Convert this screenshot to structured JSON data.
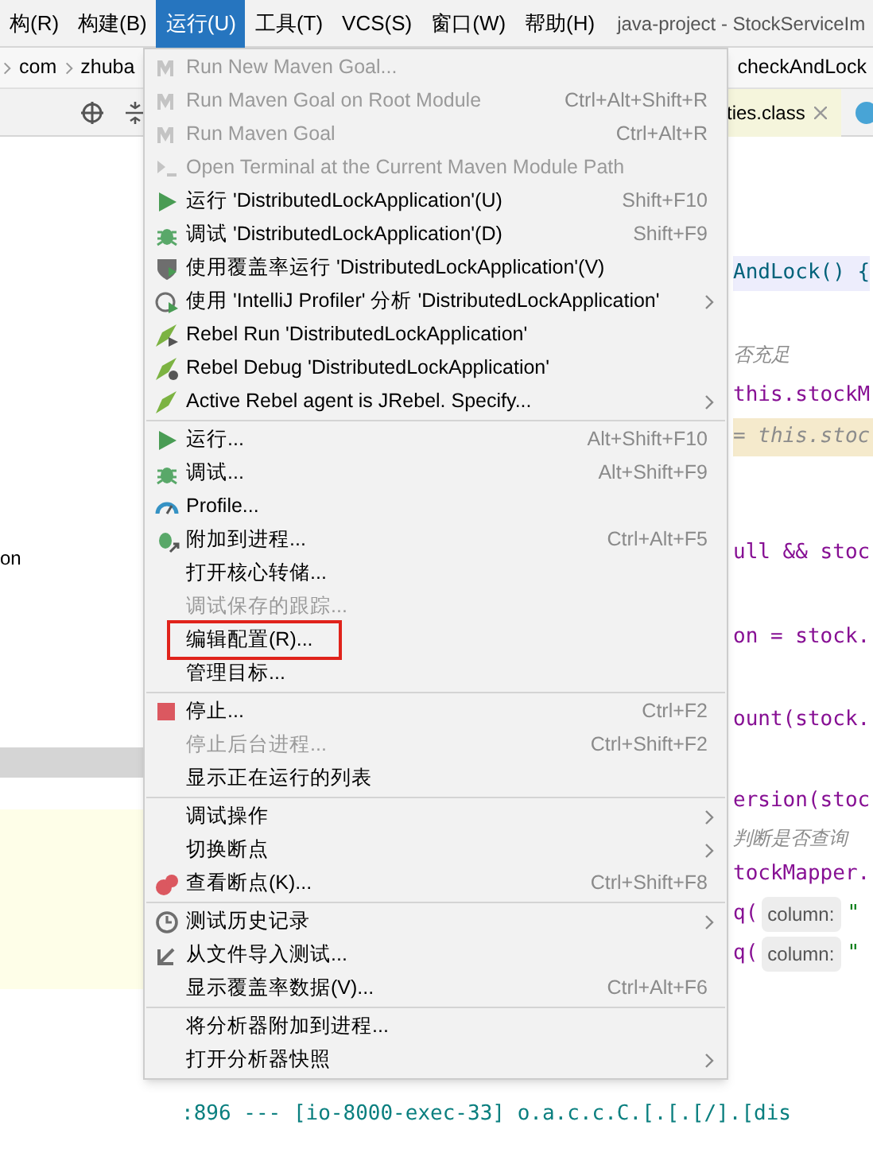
{
  "menubar": {
    "items": [
      {
        "label": "构(R)",
        "selected": false
      },
      {
        "label": "构建(B)",
        "selected": false
      },
      {
        "label": "运行(U)",
        "selected": true
      },
      {
        "label": "工具(T)",
        "selected": false
      },
      {
        "label": "VCS(S)",
        "selected": false
      },
      {
        "label": "窗口(W)",
        "selected": false
      },
      {
        "label": "帮助(H)",
        "selected": false
      }
    ],
    "title": "java-project - StockServiceIm"
  },
  "breadcrumb": {
    "items": [
      "com",
      "zhuba"
    ],
    "method": "checkAndLock"
  },
  "editor_tab": {
    "label": "ties.class"
  },
  "left_panel": {
    "text": "on"
  },
  "code_lines": [
    {
      "kind": "code",
      "text": "AndLock() {",
      "highlight": true
    },
    {
      "kind": "comment",
      "text": "否充足"
    },
    {
      "kind": "code",
      "text": "this.stockM"
    },
    {
      "kind": "current",
      "text": "= this.stoc"
    },
    {
      "kind": "code",
      "text": "ull && stoc"
    },
    {
      "kind": "code",
      "text": "on = stock."
    },
    {
      "kind": "code",
      "text": "ount(stock."
    },
    {
      "kind": "code",
      "text": "ersion(stoc"
    },
    {
      "kind": "comment",
      "text": "判断是否查询"
    },
    {
      "kind": "code",
      "text": "tockMapper."
    },
    {
      "kind": "hint",
      "text": "q(",
      "hint": "column:",
      "rest": "\""
    },
    {
      "kind": "hint",
      "text": "q(",
      "hint": "column:",
      "rest": "\""
    }
  ],
  "console_line": ":896 --- [io-8000-exec-33] o.a.c.c.C.[.[.[/].[dis",
  "run_menu": {
    "items": [
      {
        "kind": "item",
        "label": "Run New Maven Goal...",
        "disabled": true
      },
      {
        "kind": "item",
        "label": "Run Maven Goal on Root Module",
        "shortcut": "Ctrl+Alt+Shift+R",
        "disabled": true
      },
      {
        "kind": "item",
        "label": "Run Maven Goal",
        "shortcut": "Ctrl+Alt+R",
        "disabled": true
      },
      {
        "kind": "item",
        "label": "Open Terminal at the Current Maven Module Path",
        "disabled": true
      },
      {
        "kind": "item",
        "label": "运行 'DistributedLockApplication'(U)",
        "shortcut": "Shift+F10",
        "disabled": false
      },
      {
        "kind": "item",
        "label": "调试 'DistributedLockApplication'(D)",
        "shortcut": "Shift+F9",
        "disabled": false
      },
      {
        "kind": "item",
        "label": "使用覆盖率运行  'DistributedLockApplication'(V)",
        "disabled": false
      },
      {
        "kind": "item",
        "label": "使用 'IntelliJ Profiler' 分析  'DistributedLockApplication'",
        "disabled": false,
        "submenu": true
      },
      {
        "kind": "item",
        "label": "Rebel Run 'DistributedLockApplication'",
        "disabled": false
      },
      {
        "kind": "item",
        "label": "Rebel Debug 'DistributedLockApplication'",
        "disabled": false
      },
      {
        "kind": "item",
        "label": "Active Rebel agent is JRebel. Specify...",
        "disabled": false,
        "submenu": true
      },
      {
        "kind": "separator"
      },
      {
        "kind": "item",
        "label": "运行...",
        "shortcut": "Alt+Shift+F10",
        "disabled": false
      },
      {
        "kind": "item",
        "label": "调试...",
        "shortcut": "Alt+Shift+F9",
        "disabled": false
      },
      {
        "kind": "item",
        "label": "Profile...",
        "disabled": false
      },
      {
        "kind": "item",
        "label": "附加到进程...",
        "shortcut": "Ctrl+Alt+F5",
        "disabled": false
      },
      {
        "kind": "item",
        "label": "打开核心转储...",
        "disabled": false
      },
      {
        "kind": "item",
        "label": "调试保存的跟踪...",
        "disabled": true
      },
      {
        "kind": "item",
        "label": "编辑配置(R)...",
        "disabled": false,
        "outlined": true
      },
      {
        "kind": "item",
        "label": "管理目标...",
        "disabled": false
      },
      {
        "kind": "separator"
      },
      {
        "kind": "item",
        "label": "停止...",
        "shortcut": "Ctrl+F2",
        "disabled": false
      },
      {
        "kind": "item",
        "label": "停止后台进程...",
        "shortcut": "Ctrl+Shift+F2",
        "disabled": true
      },
      {
        "kind": "item",
        "label": "显示正在运行的列表",
        "disabled": false
      },
      {
        "kind": "separator"
      },
      {
        "kind": "item",
        "label": "调试操作",
        "disabled": false,
        "submenu": true
      },
      {
        "kind": "item",
        "label": "切换断点",
        "disabled": false,
        "submenu": true
      },
      {
        "kind": "item",
        "label": "查看断点(K)...",
        "shortcut": "Ctrl+Shift+F8",
        "disabled": false
      },
      {
        "kind": "separator"
      },
      {
        "kind": "item",
        "label": "测试历史记录",
        "disabled": false,
        "submenu": true
      },
      {
        "kind": "item",
        "label": "从文件导入测试...",
        "disabled": false
      },
      {
        "kind": "item",
        "label": "显示覆盖率数据(V)...",
        "shortcut": "Ctrl+Alt+F6",
        "disabled": false
      },
      {
        "kind": "separator"
      },
      {
        "kind": "item",
        "label": "将分析器附加到进程...",
        "disabled": false
      },
      {
        "kind": "item",
        "label": "打开分析器快照",
        "disabled": false,
        "submenu": true
      }
    ]
  }
}
